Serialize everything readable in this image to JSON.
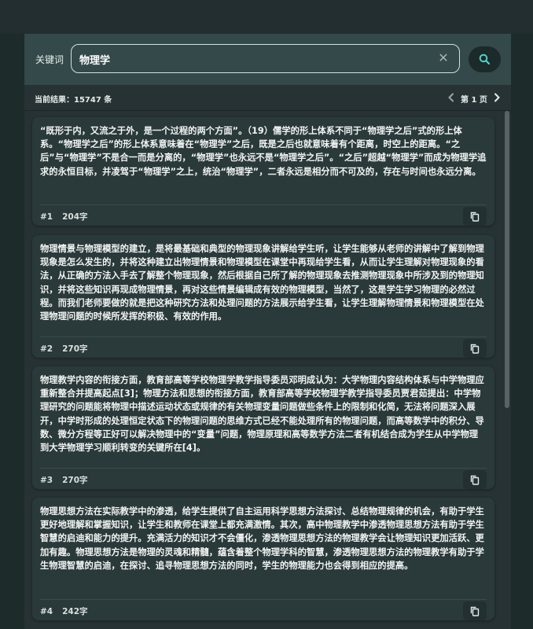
{
  "search": {
    "label": "关键词",
    "value": "物理学",
    "placeholder": "",
    "clear_icon": "close-icon",
    "button_icon": "search-icon"
  },
  "results": {
    "count_text": "当前结果：15747 条",
    "page_label": "第 1 页"
  },
  "colors": {
    "accent": "#4fd1c5",
    "background": "#1e2b2b",
    "card": "#2a393a"
  },
  "cards": [
    {
      "text": "“既形于内，又流之于外，是一个过程的两个方面”。（19）儒学的形上体系不同于“物理学之后”式的形上体系。“物理学之后”的形上体系意味着在“物理学”之后，既是之后也就意味着有个距离，时空上的距离。“之后”与“物理学”不是合一而是分离的，“物理学”也永远不是“物理学之后”。“之后”超越“物理学”而成为物理学追求的永恒目标，并凌驾于“物理学”之上，统治“物理学”，二者永远是相分而不可及的，存在与时间也永远分离。",
      "index": "#1",
      "chars": "204字"
    },
    {
      "text": "物理情景与物理模型的建立，是将最基础和典型的物理现象讲解给学生听，让学生能够从老师的讲解中了解到物理现象是怎么发生的，并将这种建立出物理情景和物理模型在课堂中再现给学生看，从而让学生理解对物理现象的看法，从正确的方法入手去了解整个物理现象，然后根据自己所了解的物理现象去推测物理现象中所涉及到的物理知识，并将这些知识再现成物理情景，再对这些情景编辑成有效的物理模型，当然了，这是学生学习物理的必然过程。而我们老师要做的就是把这种研究方法和处理问题的方法展示给学生看，让学生理解物理情景和物理模型在处理物理问题的时候所发挥的积极、有效的作用。",
      "index": "#2",
      "chars": "270字"
    },
    {
      "text": "物理教学内容的衔接方面，教育部高等学校物理学教学指导委员邓明成认为：大学物理内容结构体系与中学物理应重新整合并提高起点[3]；物理方法和思想的衔接方面，教育部高等学校物理学教学指导委员贾君茹提出：中学物理研究的问题能将物理中描述运动状态或规律的有关物理变量问题做些条件上的限制和化简，无法将问题深入展开，中学时形成的处理恒定状态下的物理问题的思维方式已经不能处理所有的物理问题，而高等数学中的积分、导数、微分方程等正好可以解决物理中的“变量”问题，物理原理和高等数学方法二者有机结合成为学生从中学物理到大学物理学习顺利转变的关键所在[4]。",
      "index": "#3",
      "chars": "270字"
    },
    {
      "text": "物理思想方法在实际教学中的渗透，给学生提供了自主运用科学思想方法探讨、总结物理规律的机会，有助于学生更好地理解和掌握知识，让学生和教师在课堂上都充满激情。其次，高中物理教学中渗透物理思想方法有助于学生智慧的启迪和能力的提升。充满活力的知识才不会僵化，渗透物理思想方法的物理教学会让物理知识更加活跃、更加有趣。物理思想方法是物理的灵魂和精髓，蕴含着整个物理学科的智慧，渗透物理思想方法的物理教学有助于学生物理智慧的启迪，在探讨、追寻物理思想方法的同时，学生的物理能力也会得到相应的提高。",
      "index": "#4",
      "chars": "242字"
    }
  ]
}
